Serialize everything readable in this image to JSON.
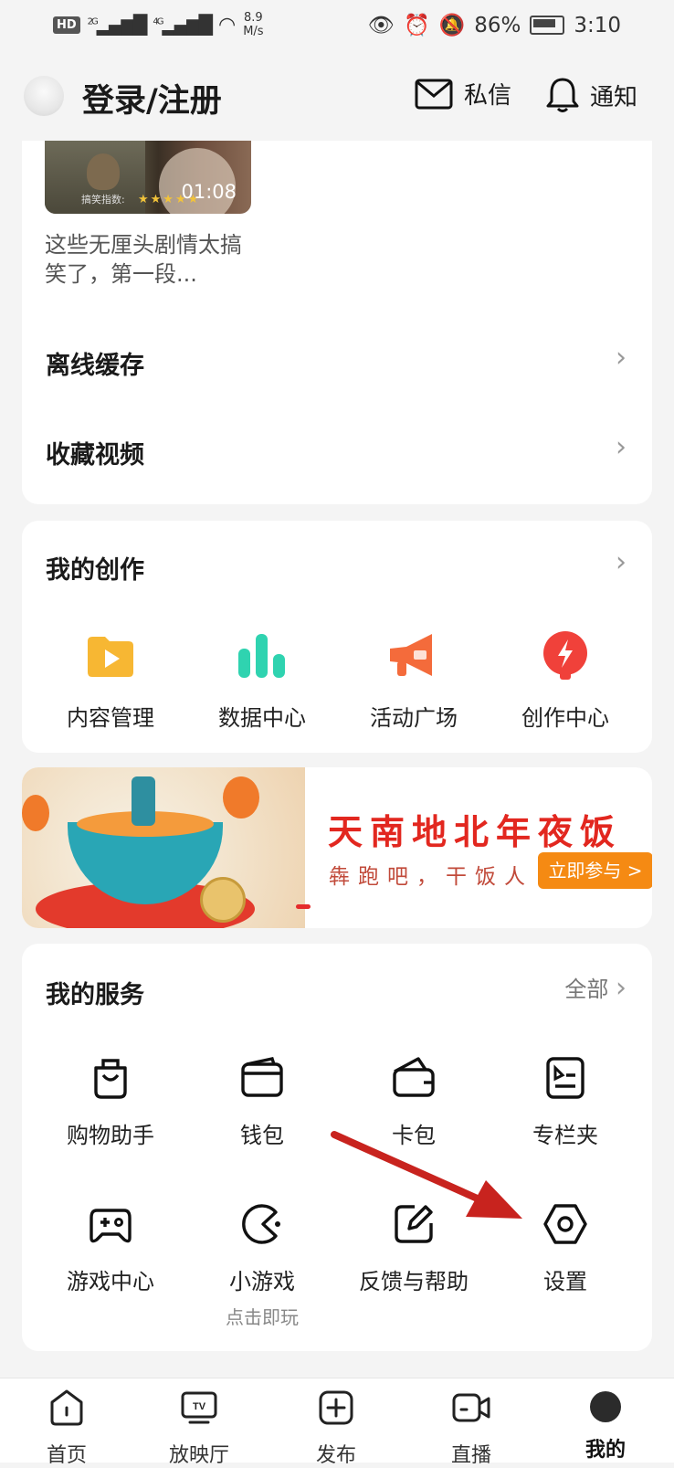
{
  "status_bar": {
    "hd": "HD",
    "net1": "2G",
    "net2": "4G",
    "speed_value": "8.9",
    "speed_unit": "M/s",
    "battery": "86%",
    "time": "3:10"
  },
  "header": {
    "login_text": "登录/注册",
    "messages_label": "私信",
    "notifications_label": "通知"
  },
  "history": {
    "video_duration": "01:08",
    "video_tag": "搞笑指数:",
    "video_title": "这些无厘头剧情太搞笑了，第一段...",
    "offline_cache": "离线缓存",
    "favorites": "收藏视频"
  },
  "creation": {
    "title": "我的创作",
    "items": [
      {
        "label": "内容管理",
        "icon": "content-management-icon",
        "color": "#f7b733"
      },
      {
        "label": "数据中心",
        "icon": "data-center-icon",
        "color": "#2fd3b0"
      },
      {
        "label": "活动广场",
        "icon": "activity-square-icon",
        "color": "#f46b3b"
      },
      {
        "label": "创作中心",
        "icon": "creator-center-icon",
        "color": "#f0413a"
      }
    ]
  },
  "banner": {
    "title": "天南地北年夜饭",
    "subtitle": "犇跑吧，干饭人",
    "cta": "立即参与 >"
  },
  "services": {
    "title": "我的服务",
    "all_label": "全部",
    "items": [
      {
        "label": "购物助手",
        "icon": "shopping-bag-icon"
      },
      {
        "label": "钱包",
        "icon": "wallet-icon"
      },
      {
        "label": "卡包",
        "icon": "card-holder-icon"
      },
      {
        "label": "专栏夹",
        "icon": "column-folder-icon"
      },
      {
        "label": "游戏中心",
        "icon": "gamepad-icon"
      },
      {
        "label": "小游戏",
        "icon": "mini-game-icon",
        "sub": "点击即玩"
      },
      {
        "label": "反馈与帮助",
        "icon": "feedback-edit-icon"
      },
      {
        "label": "设置",
        "icon": "settings-hex-icon"
      }
    ]
  },
  "tabbar": {
    "items": [
      {
        "label": "首页",
        "icon": "home-icon"
      },
      {
        "label": "放映厅",
        "icon": "tv-icon"
      },
      {
        "label": "发布",
        "icon": "publish-plus-icon"
      },
      {
        "label": "直播",
        "icon": "live-camera-icon"
      },
      {
        "label": "我的",
        "icon": "profile-avatar-icon"
      }
    ],
    "active_index": 4
  },
  "colors": {
    "accent_red": "#e2271f",
    "cta_orange": "#f58a13",
    "annotation_arrow": "#c8231e"
  }
}
